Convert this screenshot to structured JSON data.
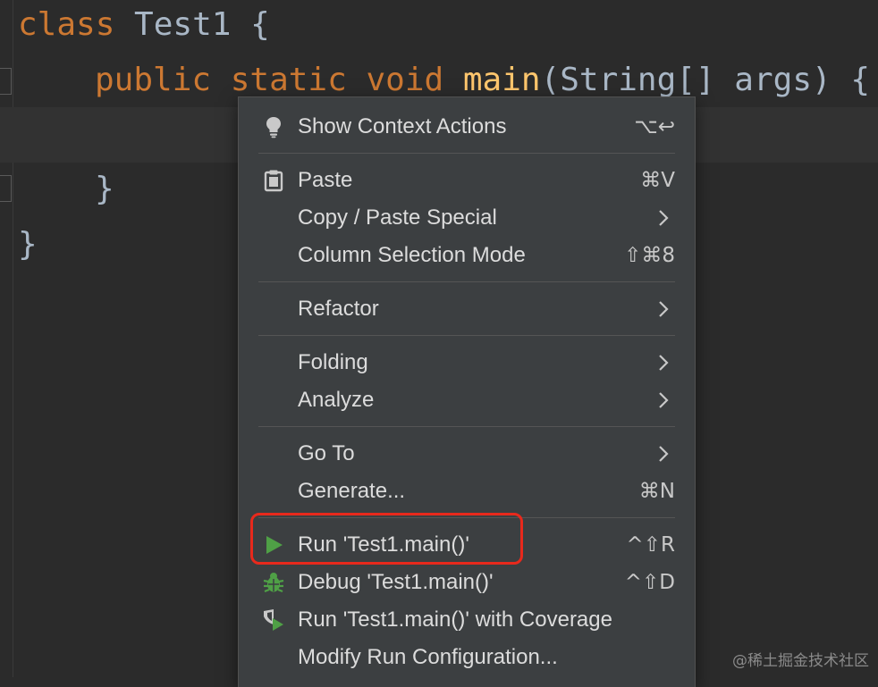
{
  "editor": {
    "line1": {
      "kw": "class",
      "name": " Test1 {"
    },
    "line2": {
      "kw1": "public",
      "kw2": "static",
      "kw3": "void",
      "fn": "main",
      "rest": "(String[] args) {"
    },
    "line4": "}",
    "line5": "}"
  },
  "menu": {
    "items": [
      {
        "label": "Show Context Actions",
        "shortcut": "⌥↩",
        "icon": "lightbulb-icon"
      },
      {
        "label": "Paste",
        "shortcut": "⌘V",
        "icon": "clipboard-icon"
      },
      {
        "label": "Copy / Paste Special",
        "submenu": true
      },
      {
        "label": "Column Selection Mode",
        "shortcut": "⇧⌘8"
      },
      {
        "label": "Refactor",
        "submenu": true
      },
      {
        "label": "Folding",
        "submenu": true
      },
      {
        "label": "Analyze",
        "submenu": true
      },
      {
        "label": "Go To",
        "submenu": true
      },
      {
        "label": "Generate...",
        "shortcut": "⌘N"
      },
      {
        "label": "Run 'Test1.main()'",
        "shortcut": "^⇧R",
        "icon": "run-icon"
      },
      {
        "label": "Debug 'Test1.main()'",
        "shortcut": "^⇧D",
        "icon": "debug-icon"
      },
      {
        "label": "Run 'Test1.main()' with Coverage",
        "icon": "coverage-icon"
      },
      {
        "label": "Modify Run Configuration..."
      }
    ]
  },
  "colors": {
    "keyword": "#cc7832",
    "function": "#ffc66d",
    "text": "#a9b7c6",
    "run_green": "#4fa046",
    "highlight_red": "#e8291c"
  },
  "watermark": "@稀土掘金技术社区"
}
